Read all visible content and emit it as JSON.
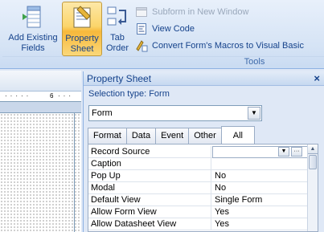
{
  "ribbon": {
    "add_existing_fields": "Add Existing\nFields",
    "add_existing_line1": "Add Existing",
    "add_existing_line2": "Fields",
    "property_sheet_line1": "Property",
    "property_sheet_line2": "Sheet",
    "tab_order_line1": "Tab",
    "tab_order_line2": "Order",
    "subform_new_window": "Subform in New Window",
    "view_code": "View Code",
    "convert_macros": "Convert Form's Macros to Visual Basic",
    "group_label": "Tools"
  },
  "ruler": {
    "tick_label": "6"
  },
  "property_sheet": {
    "title": "Property Sheet",
    "close_glyph": "×",
    "selection_type": "Selection type:  Form",
    "combo_value": "Form",
    "tabs": [
      "Format",
      "Data",
      "Event",
      "Other",
      "All"
    ],
    "active_tab": "All",
    "rows": [
      {
        "name": "Record Source",
        "value": ""
      },
      {
        "name": "Caption",
        "value": ""
      },
      {
        "name": "Pop Up",
        "value": "No"
      },
      {
        "name": "Modal",
        "value": "No"
      },
      {
        "name": "Default View",
        "value": "Single Form"
      },
      {
        "name": "Allow Form View",
        "value": "Yes"
      },
      {
        "name": "Allow Datasheet View",
        "value": "Yes"
      }
    ],
    "build_button_glyph": "···"
  },
  "colors": {
    "ribbon_text": "#15428b",
    "active_button": "#fbd56c",
    "panel_bg": "#dfe8f6"
  }
}
